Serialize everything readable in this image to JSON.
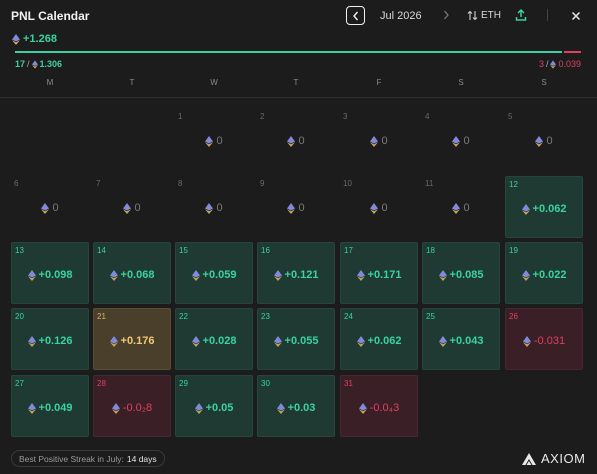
{
  "header": {
    "title": "PNL Calendar",
    "month": "Jul 2026",
    "currency": "ETH"
  },
  "summary": {
    "total": "+1.268",
    "win_days": "17",
    "win_sep": "/",
    "win_total": "1.306",
    "loss_days": "3",
    "loss_sep": "/",
    "loss_total": "0.039",
    "win_fraction": 0.97
  },
  "weekdays": [
    "M",
    "T",
    "W",
    "T",
    "F",
    "S",
    "S"
  ],
  "days": [
    {
      "day": "1",
      "value": "0",
      "state": "empty"
    },
    {
      "day": "2",
      "value": "0",
      "state": "empty"
    },
    {
      "day": "3",
      "value": "0",
      "state": "empty"
    },
    {
      "day": "4",
      "value": "0",
      "state": "empty"
    },
    {
      "day": "5",
      "value": "0",
      "state": "empty"
    },
    {
      "day": "6",
      "value": "0",
      "state": "empty"
    },
    {
      "day": "7",
      "value": "0",
      "state": "empty"
    },
    {
      "day": "8",
      "value": "0",
      "state": "empty"
    },
    {
      "day": "9",
      "value": "0",
      "state": "empty"
    },
    {
      "day": "10",
      "value": "0",
      "state": "empty"
    },
    {
      "day": "11",
      "value": "0",
      "state": "empty"
    },
    {
      "day": "12",
      "value": "+0.062",
      "state": "pos"
    },
    {
      "day": "13",
      "value": "+0.098",
      "state": "pos"
    },
    {
      "day": "14",
      "value": "+0.068",
      "state": "pos"
    },
    {
      "day": "15",
      "value": "+0.059",
      "state": "pos"
    },
    {
      "day": "16",
      "value": "+0.121",
      "state": "pos"
    },
    {
      "day": "17",
      "value": "+0.171",
      "state": "pos"
    },
    {
      "day": "18",
      "value": "+0.085",
      "state": "pos"
    },
    {
      "day": "19",
      "value": "+0.022",
      "state": "pos"
    },
    {
      "day": "20",
      "value": "+0.126",
      "state": "pos"
    },
    {
      "day": "21",
      "value": "+0.176",
      "state": "best"
    },
    {
      "day": "22",
      "value": "+0.028",
      "state": "pos"
    },
    {
      "day": "23",
      "value": "+0.055",
      "state": "pos"
    },
    {
      "day": "24",
      "value": "+0.062",
      "state": "pos"
    },
    {
      "day": "25",
      "value": "+0.043",
      "state": "pos"
    },
    {
      "day": "26",
      "value": "-0.031",
      "state": "neg"
    },
    {
      "day": "27",
      "value": "+0.049",
      "state": "pos"
    },
    {
      "day": "28",
      "value": "-0.0₂8",
      "state": "neg"
    },
    {
      "day": "29",
      "value": "+0.05",
      "state": "pos"
    },
    {
      "day": "30",
      "value": "+0.03",
      "state": "pos"
    },
    {
      "day": "31",
      "value": "-0.0₄3",
      "state": "neg"
    }
  ],
  "footer": {
    "streak_label": "Best Positive Streak in July:",
    "streak_value": "14 days",
    "brand": "AXIOM"
  },
  "colors": {
    "positive": "#3ad29f",
    "negative": "#e0405e",
    "best": "#f0c878"
  },
  "icons": {
    "prev": "chevron-left-icon",
    "next": "chevron-right-icon",
    "toggle": "swap-arrows-icon",
    "share": "upload-icon",
    "close": "close-icon",
    "currency": "eth-icon"
  }
}
